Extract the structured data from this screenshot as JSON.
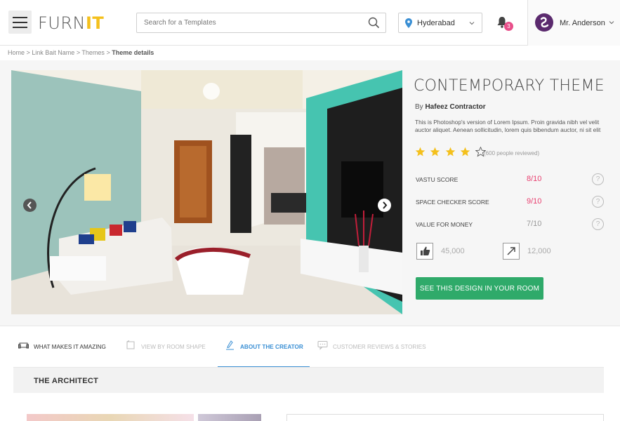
{
  "header": {
    "logo_part1": "FURN",
    "logo_part2": "IT",
    "search_placeholder": "Search for a Templates",
    "location": "Hyderabad",
    "notification_count": "3",
    "user_name": "Mr. Anderson"
  },
  "breadcrumb": {
    "items": [
      "Home",
      "Link Bait Name",
      "Themes"
    ],
    "separator": " > ",
    "current": "Theme details"
  },
  "theme": {
    "title": "CONTEMPORARY THEME",
    "by_label": "By",
    "author": "Hafeez Contractor",
    "description": "This is Photoshop's version  of Lorem Ipsum. Proin gravida nibh vel velit auctor aliquet. Aenean sollicitudin, lorem quis bibendum auctor, ni sit elit",
    "rating": 4,
    "rating_max": 5,
    "reviews": "(600 people reviewed)",
    "scores": [
      {
        "label": "VASTU SCORE",
        "value": "8/10",
        "highlight": true
      },
      {
        "label": "SPACE CHECKER SCORE",
        "value": "9/10",
        "highlight": true
      },
      {
        "label": "VALUE FOR MONEY",
        "value": "7/10",
        "highlight": false
      }
    ],
    "likes": "45,000",
    "shares": "12,000",
    "cta": "SEE THIS DESIGN IN YOUR ROOM"
  },
  "tabs": [
    {
      "label": "WHAT MAKES IT AMAZING",
      "icon": "sofa-icon",
      "state": "normal"
    },
    {
      "label": "VIEW BY ROOM SHAPE",
      "icon": "room-icon",
      "state": "disabled"
    },
    {
      "label": "ABOUT THE CREATOR",
      "icon": "pencil-icon",
      "state": "active"
    },
    {
      "label": "CUSTOMER REVIEWS & STORIES",
      "icon": "chat-icon",
      "state": "disabled"
    }
  ],
  "section": {
    "title": "THE ARCHITECT"
  },
  "colors": {
    "accent_yellow": "#f4c01c",
    "score_pink": "#e83f6f",
    "cta_green": "#2faa6a",
    "tab_blue": "#3a8fd4",
    "badge_pink": "#e84f8a"
  }
}
